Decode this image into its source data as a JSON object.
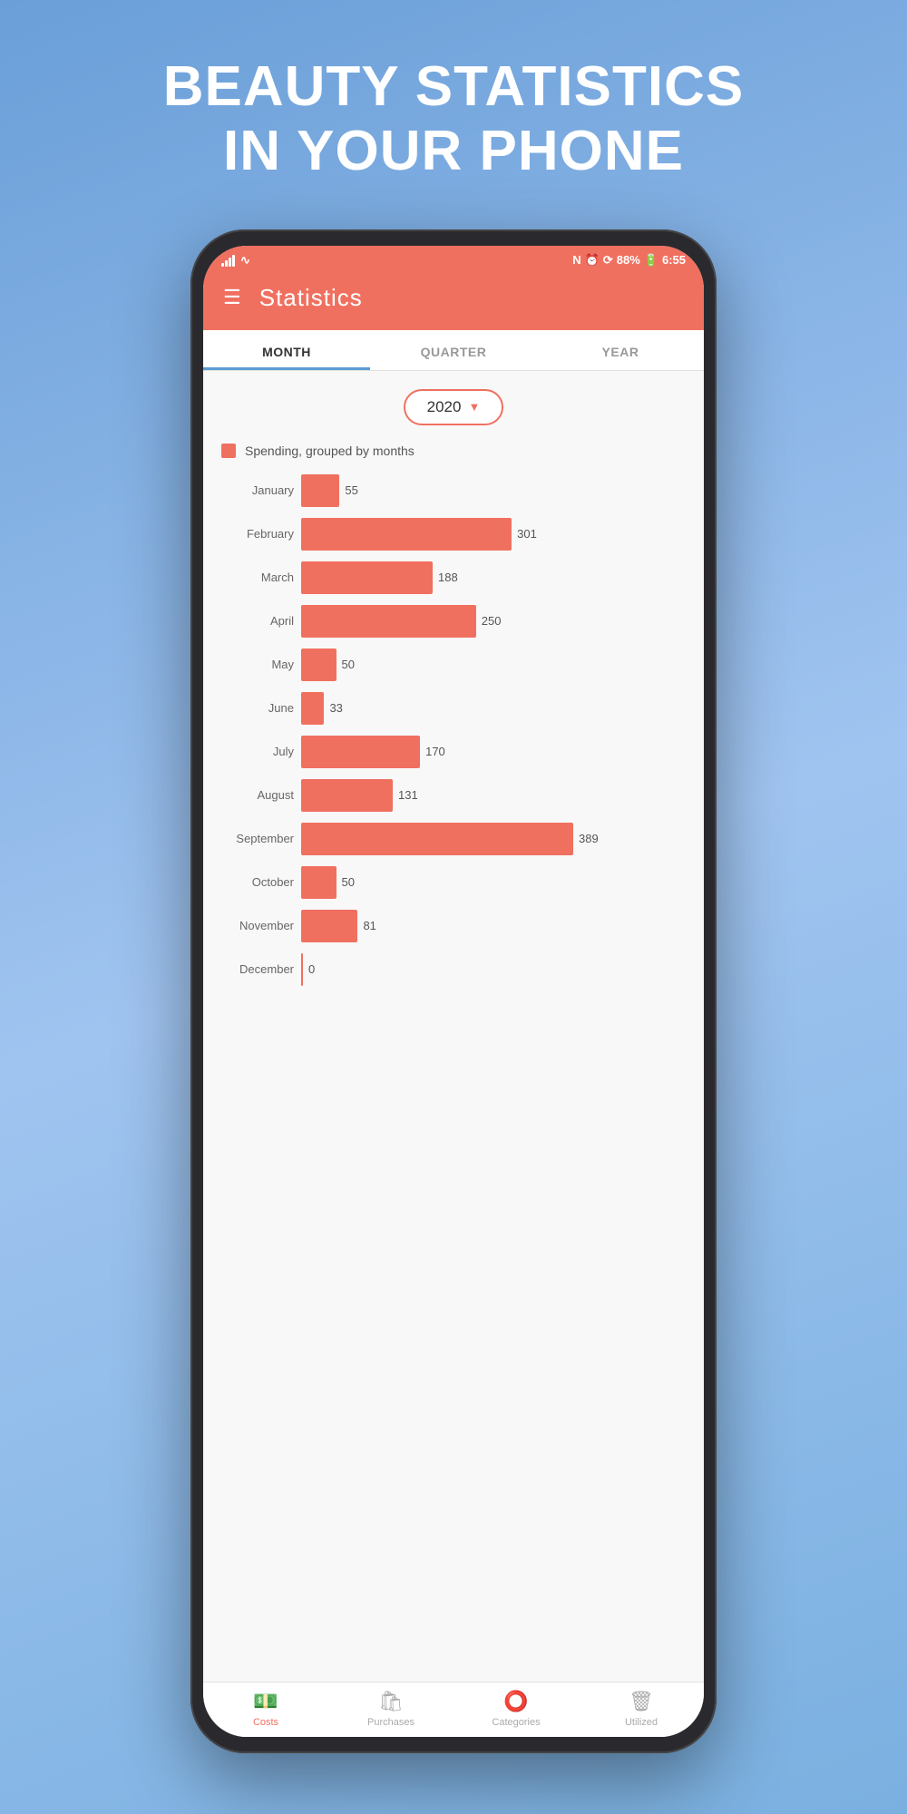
{
  "hero": {
    "line1": "BEAUTY STATISTICS",
    "line2": "IN YOUR PHONE"
  },
  "status_bar": {
    "battery": "88%",
    "time": "6:55"
  },
  "header": {
    "title": "Statistics"
  },
  "tabs": [
    {
      "label": "MONTH",
      "active": true
    },
    {
      "label": "QUARTER",
      "active": false
    },
    {
      "label": "YEAR",
      "active": false
    }
  ],
  "year_selector": {
    "value": "2020"
  },
  "legend": {
    "label": "Spending, grouped by months"
  },
  "chart": {
    "max_value": 389,
    "rows": [
      {
        "month": "January",
        "value": 55
      },
      {
        "month": "February",
        "value": 301
      },
      {
        "month": "March",
        "value": 188
      },
      {
        "month": "April",
        "value": 250
      },
      {
        "month": "May",
        "value": 50
      },
      {
        "month": "June",
        "value": 33
      },
      {
        "month": "July",
        "value": 170
      },
      {
        "month": "August",
        "value": 131
      },
      {
        "month": "September",
        "value": 389
      },
      {
        "month": "October",
        "value": 50
      },
      {
        "month": "November",
        "value": 81
      },
      {
        "month": "December",
        "value": 0
      }
    ]
  },
  "bottom_nav": [
    {
      "label": "Costs",
      "icon": "💵",
      "active": true
    },
    {
      "label": "Purchases",
      "icon": "🛍",
      "active": false
    },
    {
      "label": "Categories",
      "icon": "⭕",
      "active": false
    },
    {
      "label": "Utilized",
      "icon": "🗑",
      "active": false
    }
  ],
  "colors": {
    "accent": "#f07060",
    "active_tab_underline": "#5b9bd5"
  }
}
